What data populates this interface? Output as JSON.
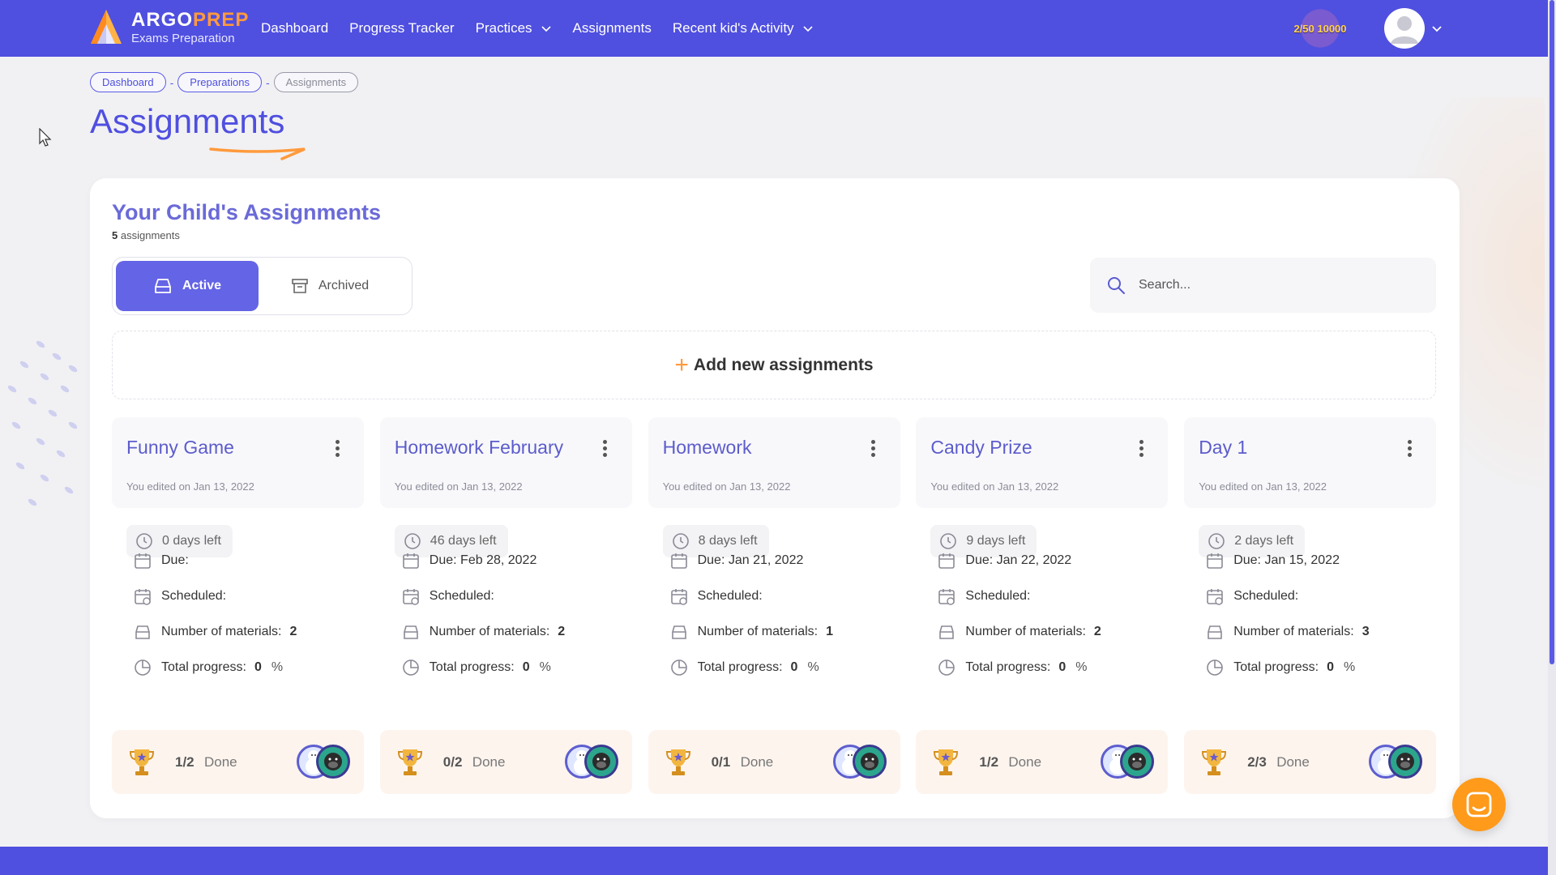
{
  "header": {
    "logo": {
      "title_part1": "ARGO",
      "title_part2": "PREP",
      "subtitle": "Exams Preparation"
    },
    "nav": [
      {
        "label": "Dashboard",
        "has_dropdown": false
      },
      {
        "label": "Progress Tracker",
        "has_dropdown": false
      },
      {
        "label": "Practices",
        "has_dropdown": true
      },
      {
        "label": "Assignments",
        "has_dropdown": false
      },
      {
        "label": "Recent kid's Activity",
        "has_dropdown": true
      }
    ],
    "score_badge": "2/50 10000"
  },
  "breadcrumb": [
    "Dashboard",
    "Preparations",
    "Assignments"
  ],
  "page_title": "Assignments",
  "panel": {
    "title": "Your Child's Assignments",
    "count": "5",
    "count_label": "assignments",
    "tabs": {
      "active": "Active",
      "archived": "Archived"
    },
    "search_placeholder": "Search...",
    "add_label": "Add new assignments"
  },
  "labels": {
    "due": "Due:",
    "scheduled": "Scheduled:",
    "materials": "Number of materials:",
    "progress": "Total progress:",
    "percent": "%",
    "done": "Done"
  },
  "assignments": [
    {
      "title": "Funny Game",
      "edited": "You edited on Jan 13, 2022",
      "days_left": "0 days left",
      "due": "",
      "scheduled": "",
      "materials": "2",
      "progress": "0",
      "done": "1/2"
    },
    {
      "title": "Homework February",
      "edited": "You edited on Jan 13, 2022",
      "days_left": "46 days left",
      "due": "Feb 28, 2022",
      "scheduled": "",
      "materials": "2",
      "progress": "0",
      "done": "0/2"
    },
    {
      "title": "Homework",
      "edited": "You edited on Jan 13, 2022",
      "days_left": "8 days left",
      "due": "Jan 21, 2022",
      "scheduled": "",
      "materials": "1",
      "progress": "0",
      "done": "0/1"
    },
    {
      "title": "Candy Prize",
      "edited": "You edited on Jan 13, 2022",
      "days_left": "9 days left",
      "due": "Jan 22, 2022",
      "scheduled": "",
      "materials": "2",
      "progress": "0",
      "done": "1/2"
    },
    {
      "title": "Day 1",
      "edited": "You edited on Jan 13, 2022",
      "days_left": "2 days left",
      "due": "Jan 15, 2022",
      "scheduled": "",
      "materials": "3",
      "progress": "0",
      "done": "2/3"
    }
  ],
  "colors": {
    "primary": "#4f4fe0",
    "accent": "#ff9a3c",
    "card_title": "#5c5ccc"
  }
}
